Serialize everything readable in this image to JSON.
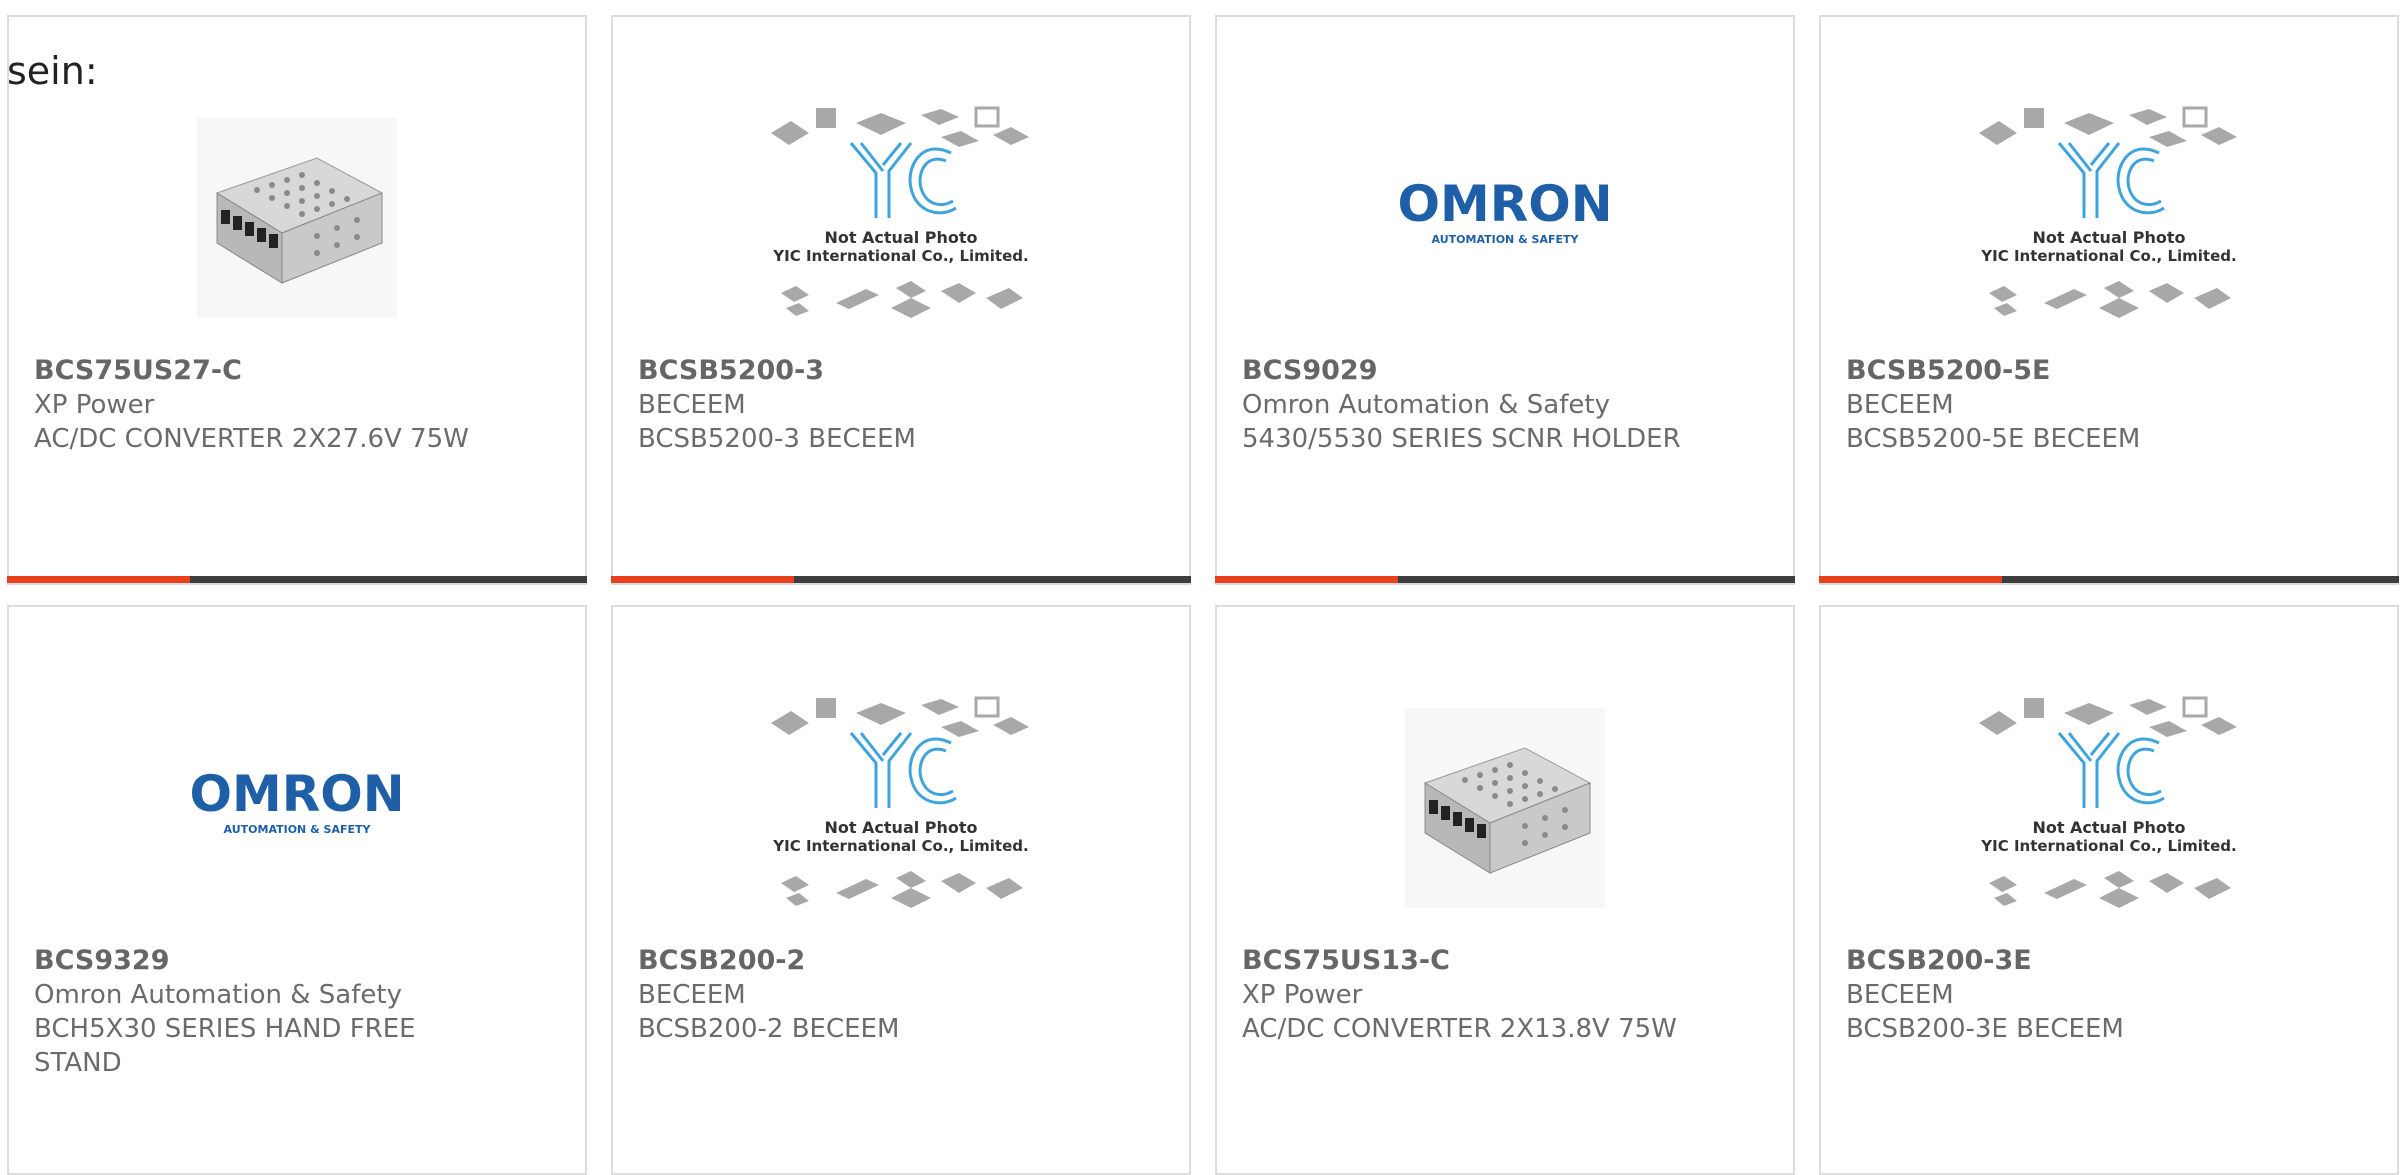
{
  "page": {
    "lead_text": "sein:",
    "accent_color": "#e8401c",
    "bar_color": "#3d3d3d"
  },
  "placeholder": {
    "brand": "YIC",
    "line1": "Not Actual Photo",
    "line2": "YIC International Co., Limited."
  },
  "omron": {
    "brand": "OMRON",
    "tagline": "AUTOMATION & SAFETY",
    "color": "#1f5fa8"
  },
  "products": [
    {
      "part": "BCS75US27-C",
      "manufacturer": "XP Power",
      "description": "AC/DC CONVERTER 2X27.6V 75W",
      "image": "power-supply-photo"
    },
    {
      "part": "BCSB5200-3",
      "manufacturer": "BECEEM",
      "description": "BCSB5200-3 BECEEM",
      "image": "yic-placeholder"
    },
    {
      "part": "BCS9029",
      "manufacturer": "Omron Automation & Safety",
      "description": "5430/5530 SERIES SCNR HOLDER",
      "image": "omron-logo"
    },
    {
      "part": "BCSB5200-5E",
      "manufacturer": "BECEEM",
      "description": "BCSB5200-5E BECEEM",
      "image": "yic-placeholder"
    },
    {
      "part": "BCS9329",
      "manufacturer": "Omron Automation & Safety",
      "description": "BCH5X30 SERIES HAND FREE STAND",
      "image": "omron-logo"
    },
    {
      "part": "BCSB200-2",
      "manufacturer": "BECEEM",
      "description": "BCSB200-2 BECEEM",
      "image": "yic-placeholder"
    },
    {
      "part": "BCS75US13-C",
      "manufacturer": "XP Power",
      "description": "AC/DC CONVERTER 2X13.8V 75W",
      "image": "power-supply-photo"
    },
    {
      "part": "BCSB200-3E",
      "manufacturer": "BECEEM",
      "description": "BCSB200-3E BECEEM",
      "image": "yic-placeholder"
    }
  ]
}
